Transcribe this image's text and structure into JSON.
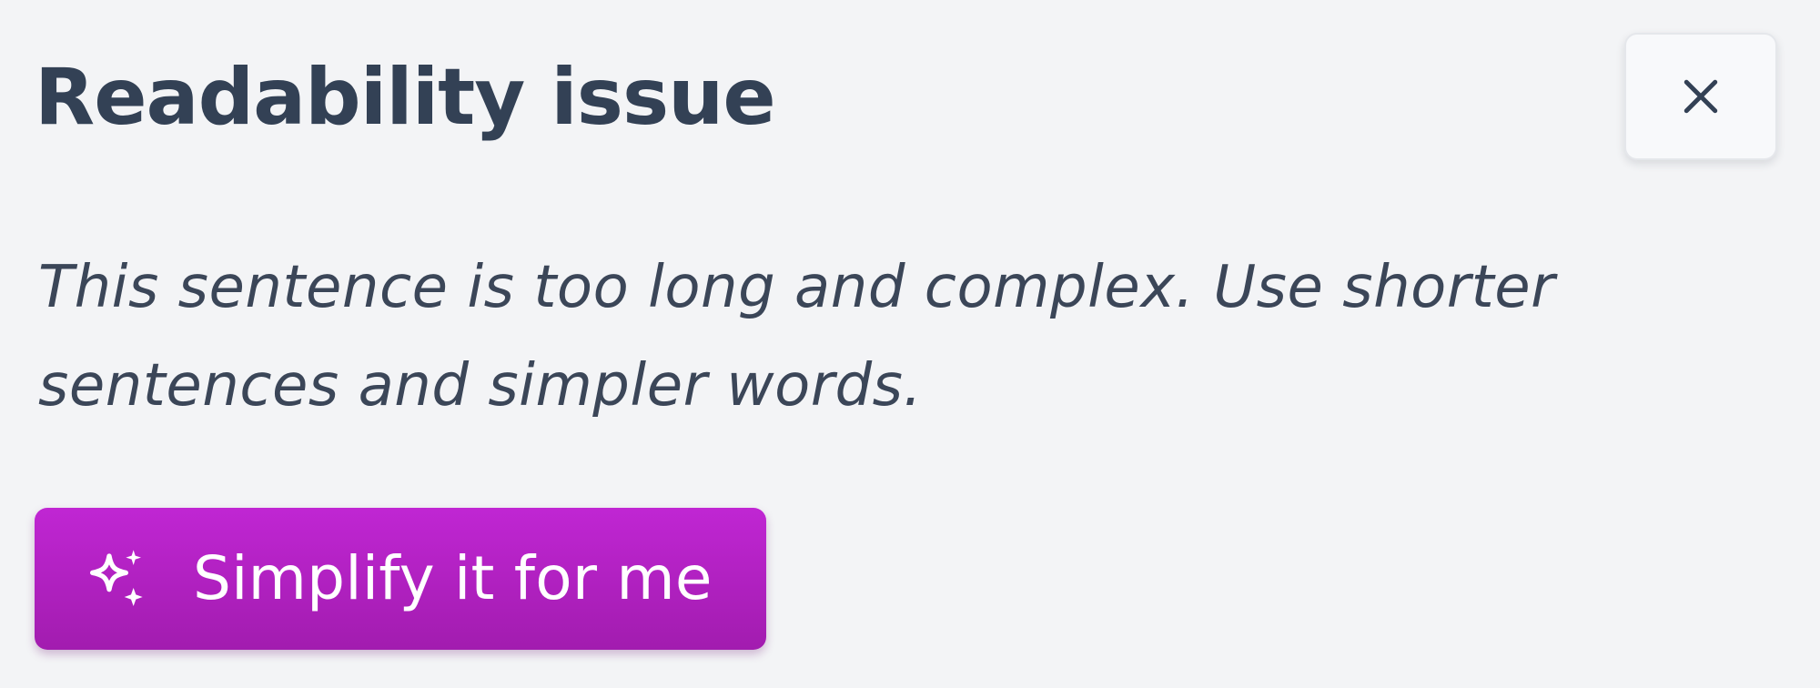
{
  "dialog": {
    "title": "Readability issue",
    "message": "This sentence is too long and complex. Use shorter sentences and simpler words.",
    "close_icon": "close-icon",
    "action": {
      "label": "Simplify it for me",
      "icon": "sparkles-icon"
    }
  },
  "colors": {
    "background": "#f3f4f6",
    "text": "#334155",
    "accent": "#c026d3",
    "accent_dark": "#a21caf",
    "button_text": "#ffffff"
  }
}
